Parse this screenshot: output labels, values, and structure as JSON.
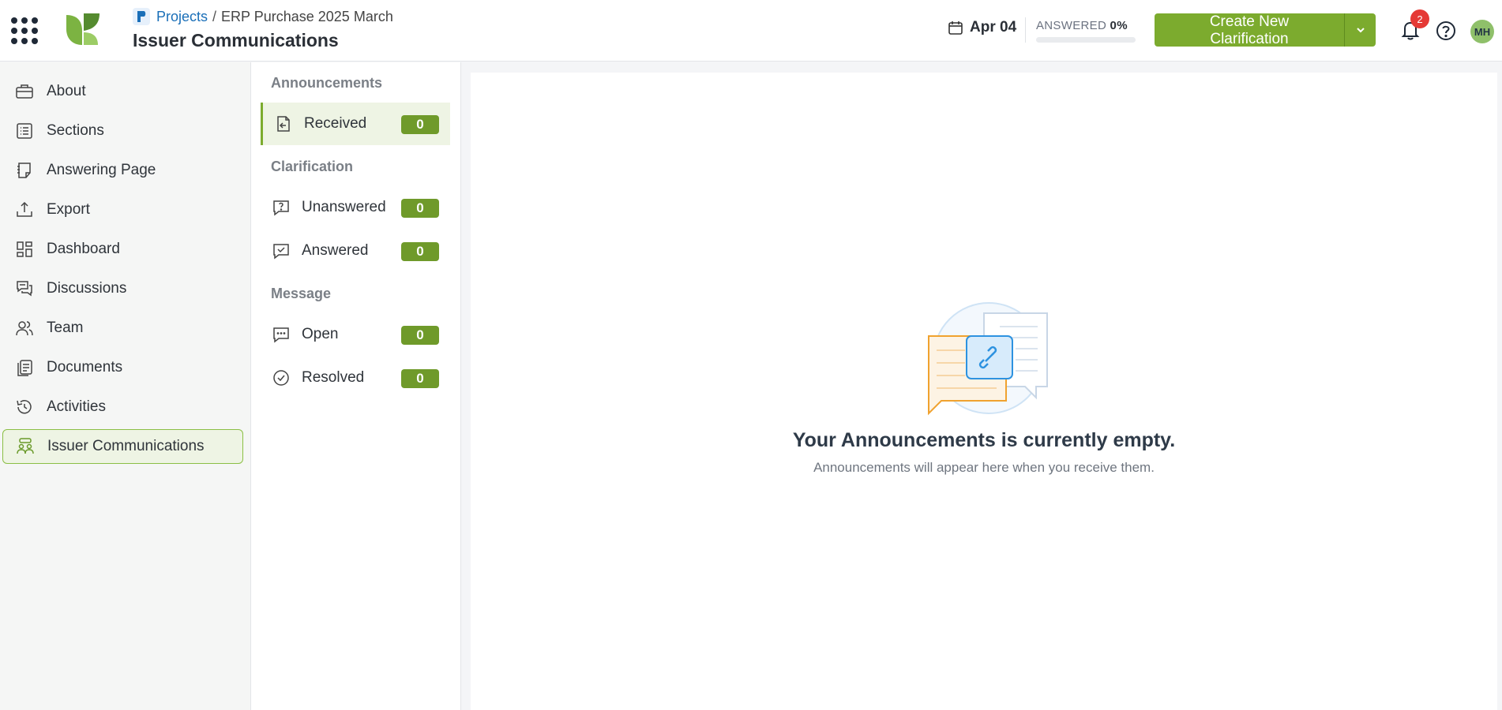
{
  "breadcrumb": {
    "link": "Projects",
    "separator": "/",
    "current": "ERP Purchase 2025 March"
  },
  "page_title": "Issuer Communications",
  "header": {
    "date": "Apr 04",
    "answered_label": "ANSWERED",
    "answered_value": "0%",
    "answered_fraction": 0,
    "create_button": "Create New Clarification",
    "notification_count": "2",
    "avatar_initials": "MH"
  },
  "nav": {
    "items": [
      {
        "label": "About",
        "icon": "briefcase-icon"
      },
      {
        "label": "Sections",
        "icon": "list-icon"
      },
      {
        "label": "Answering Page",
        "icon": "notebook-icon"
      },
      {
        "label": "Export",
        "icon": "upload-icon"
      },
      {
        "label": "Dashboard",
        "icon": "dashboard-icon"
      },
      {
        "label": "Discussions",
        "icon": "chat-icon"
      },
      {
        "label": "Team",
        "icon": "team-icon"
      },
      {
        "label": "Documents",
        "icon": "documents-icon"
      },
      {
        "label": "Activities",
        "icon": "history-icon"
      },
      {
        "label": "Issuer Communications",
        "icon": "issuer-comms-icon"
      }
    ]
  },
  "panel": {
    "announcements": {
      "heading": "Announcements",
      "received": {
        "label": "Received",
        "count": "0"
      }
    },
    "clarification": {
      "heading": "Clarification",
      "unanswered": {
        "label": "Unanswered",
        "count": "0"
      },
      "answered": {
        "label": "Answered",
        "count": "0"
      }
    },
    "message": {
      "heading": "Message",
      "open": {
        "label": "Open",
        "count": "0"
      },
      "resolved": {
        "label": "Resolved",
        "count": "0"
      }
    }
  },
  "empty_state": {
    "title": "Your Announcements is currently empty.",
    "subtitle": "Announcements will appear here when you receive them."
  },
  "colors": {
    "accent": "#7cab2e",
    "badge": "#6f9a2a",
    "active_bg": "#eef4e4",
    "notification": "#e53935"
  }
}
